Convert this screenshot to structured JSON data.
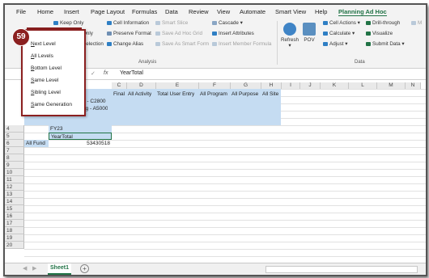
{
  "menu": {
    "tabs": [
      "File",
      "Home",
      "Insert",
      "Page Layout",
      "Formulas",
      "Data",
      "Review",
      "View",
      "Automate",
      "Smart View",
      "Help",
      "Planning Ad Hoc"
    ],
    "active": "Planning Ad Hoc"
  },
  "ribbon": {
    "keep_only": "Keep Only",
    "only": "Only",
    "selection": "Selection",
    "cell_information": "Cell Information",
    "preserve_format": "Preserve Format",
    "change_alias": "Change Alias",
    "smart_slice": "Smart Slice",
    "save_ad_hoc_grid": "Save Ad Hoc Grid",
    "save_as_smart_form": "Save As Smart Form",
    "cascade": "Cascade",
    "insert_attributes": "Insert Attributes",
    "insert_member_formula": "Insert Member Formula",
    "group_analysis": "Analysis",
    "refresh": "Refresh",
    "pov": "POV",
    "cell_actions": "Cell Actions",
    "calculate": "Calculate",
    "adjust": "Adjust",
    "drill_through": "Drill-through",
    "visualize": "Visualize",
    "submit_data": "Submit Data",
    "more": "M",
    "group_data": "Data"
  },
  "formula_bar": {
    "cross": "×",
    "check": "✓",
    "fx": "fx",
    "value": "YearTotal"
  },
  "columns": [
    "C",
    "D",
    "E",
    "F",
    "G",
    "H",
    "I",
    "J",
    "K",
    "L",
    "M",
    "N"
  ],
  "grid": {
    "row1_headers": [
      "Final",
      "All Activity",
      "Total User Entry",
      "All Program",
      "All Purpose",
      "All Site"
    ],
    "b2": "h - C2800",
    "b3": "ng - A5000",
    "b4": "FY23",
    "b5": "YearTotal",
    "a6": "All Fund",
    "b6": "53430518"
  },
  "rows": [
    "4",
    "5",
    "6",
    "7",
    "8",
    "9",
    "10",
    "11",
    "12",
    "13",
    "14",
    "15",
    "16",
    "17",
    "18",
    "19",
    "20"
  ],
  "dropdown": {
    "items": [
      "Next Level",
      "All Levels",
      "Bottom Level",
      "Same Level",
      "Sibling Level",
      "Same Generation"
    ]
  },
  "badge": "59",
  "sheet": {
    "tab": "Sheet1",
    "add": "+"
  },
  "colors": {
    "accent": "#217346",
    "callout": "#8b2020",
    "highlight": "#c5dcf2"
  }
}
